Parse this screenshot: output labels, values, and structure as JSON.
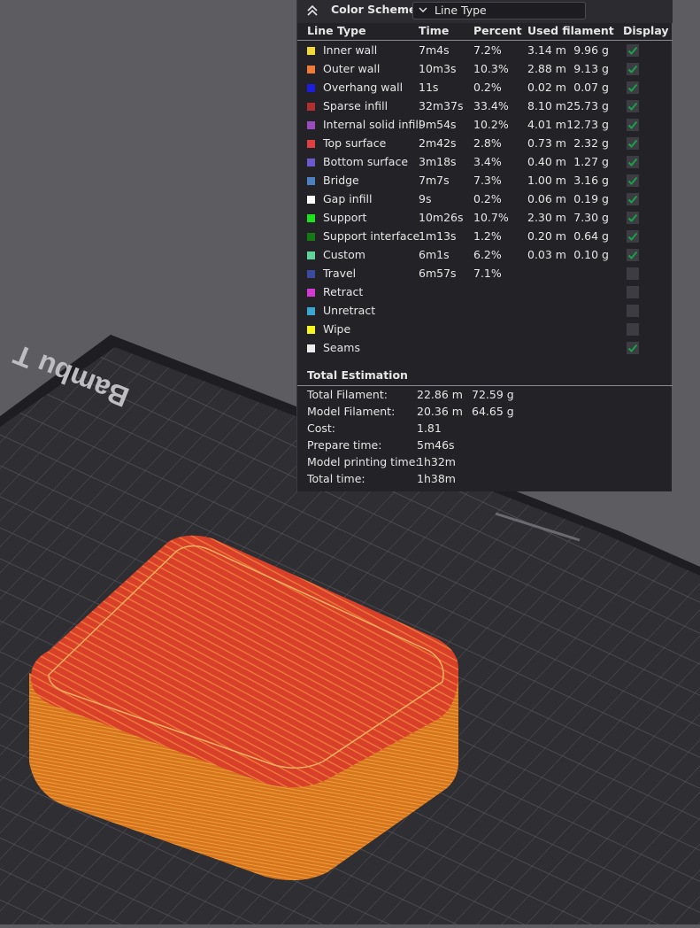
{
  "panel": {
    "title": "Color Scheme",
    "scheme_selected": "Line Type",
    "headers": {
      "line_type": "Line Type",
      "time": "Time",
      "percent": "Percent",
      "used_filament": "Used filament",
      "display": "Display"
    },
    "rows": [
      {
        "name": "Inner wall",
        "time": "7m4s",
        "percent": "7.2%",
        "length": "3.14 m",
        "weight": "9.96 g",
        "color": "#f0d83a",
        "display": true
      },
      {
        "name": "Outer wall",
        "time": "10m3s",
        "percent": "10.3%",
        "length": "2.88 m",
        "weight": "9.13 g",
        "color": "#f07a3a",
        "display": true
      },
      {
        "name": "Overhang wall",
        "time": "11s",
        "percent": "0.2%",
        "length": "0.02 m",
        "weight": "0.07 g",
        "color": "#1d1ce0",
        "display": true
      },
      {
        "name": "Sparse infill",
        "time": "32m37s",
        "percent": "33.4%",
        "length": "8.10 m",
        "weight": "25.73 g",
        "color": "#b03030",
        "display": true
      },
      {
        "name": "Internal solid infill",
        "time": "9m54s",
        "percent": "10.2%",
        "length": "4.01 m",
        "weight": "12.73 g",
        "color": "#9a4cbf",
        "display": true
      },
      {
        "name": "Top surface",
        "time": "2m42s",
        "percent": "2.8%",
        "length": "0.73 m",
        "weight": "2.32 g",
        "color": "#e04040",
        "display": true
      },
      {
        "name": "Bottom surface",
        "time": "3m18s",
        "percent": "3.4%",
        "length": "0.40 m",
        "weight": "1.27 g",
        "color": "#6a5acd",
        "display": true
      },
      {
        "name": "Bridge",
        "time": "7m7s",
        "percent": "7.3%",
        "length": "1.00 m",
        "weight": "3.16 g",
        "color": "#4d80bf",
        "display": true
      },
      {
        "name": "Gap infill",
        "time": "9s",
        "percent": "0.2%",
        "length": "0.06 m",
        "weight": "0.19 g",
        "color": "#ffffff",
        "display": true
      },
      {
        "name": "Support",
        "time": "10m26s",
        "percent": "10.7%",
        "length": "2.30 m",
        "weight": "7.30 g",
        "color": "#1fe21f",
        "display": true
      },
      {
        "name": "Support interface",
        "time": "1m13s",
        "percent": "1.2%",
        "length": "0.20 m",
        "weight": "0.64 g",
        "color": "#157a15",
        "display": true
      },
      {
        "name": "Custom",
        "time": "6m1s",
        "percent": "6.2%",
        "length": "0.03 m",
        "weight": "0.10 g",
        "color": "#5fd39a",
        "display": true
      },
      {
        "name": "Travel",
        "time": "6m57s",
        "percent": "7.1%",
        "length": "",
        "weight": "",
        "color": "#3a4aa0",
        "display": false
      },
      {
        "name": "Retract",
        "time": "",
        "percent": "",
        "length": "",
        "weight": "",
        "color": "#d23ad2",
        "display": false
      },
      {
        "name": "Unretract",
        "time": "",
        "percent": "",
        "length": "",
        "weight": "",
        "color": "#3aa6d2",
        "display": false
      },
      {
        "name": "Wipe",
        "time": "",
        "percent": "",
        "length": "",
        "weight": "",
        "color": "#f5f51f",
        "display": false
      },
      {
        "name": "Seams",
        "time": "",
        "percent": "",
        "length": "",
        "weight": "",
        "color": "#ececec",
        "display": true
      }
    ],
    "total_title": "Total Estimation",
    "totals": [
      {
        "label": "Total Filament:",
        "v1": "22.86 m",
        "v2": "72.59 g"
      },
      {
        "label": "Model Filament:",
        "v1": "20.36 m",
        "v2": "64.65 g"
      },
      {
        "label": "Cost:",
        "v1": "1.81",
        "v2": ""
      },
      {
        "label": "Prepare time:",
        "v1": "5m46s",
        "v2": ""
      },
      {
        "label": "Model printing time:",
        "v1": "1h32m",
        "v2": ""
      },
      {
        "label": "Total time:",
        "v1": "1h38m",
        "v2": ""
      }
    ],
    "check_color": "#1aa04a"
  },
  "viewport": {
    "bed_logo": "Bambu T",
    "background": "#5d5c61",
    "plate_color": "#2f2e33",
    "model_top_color": "#d8402a",
    "model_side_color": "#d9741e"
  },
  "icons": {
    "collapse": "double-chevron-up-icon",
    "dropdown": "chevron-down-icon",
    "check": "checkmark-icon"
  }
}
